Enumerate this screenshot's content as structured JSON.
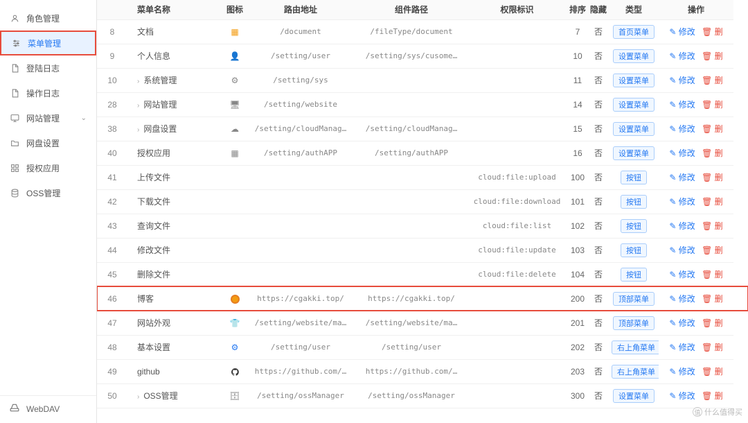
{
  "sidebar": {
    "items": [
      {
        "label": "角色管理",
        "icon": "user-icon"
      },
      {
        "label": "菜单管理",
        "icon": "sliders-icon",
        "active": true
      },
      {
        "label": "登陆日志",
        "icon": "file-icon"
      },
      {
        "label": "操作日志",
        "icon": "file-icon"
      },
      {
        "label": "网站管理",
        "icon": "monitor-icon",
        "expandable": true
      },
      {
        "label": "网盘设置",
        "icon": "folder-icon"
      },
      {
        "label": "授权应用",
        "icon": "app-icon"
      },
      {
        "label": "OSS管理",
        "icon": "database-icon"
      }
    ],
    "bottom": {
      "label": "WebDAV",
      "icon": "drive-icon"
    }
  },
  "headers": {
    "id": "",
    "name": "菜单名称",
    "icon": "图标",
    "route": "路由地址",
    "component": "组件路径",
    "permission": "权限标识",
    "sort": "排序",
    "hidden": "隐藏",
    "type": "类型",
    "ops": "操作"
  },
  "typeLabels": {
    "home": "首页菜单",
    "setting": "设置菜单",
    "button": "按钮",
    "top": "顶部菜单",
    "corner": "右上角菜单"
  },
  "opsLabels": {
    "edit": "修改",
    "delete": "删"
  },
  "hiddenNo": "否",
  "rows": [
    {
      "id": 8,
      "name": "文档",
      "icon": "doc",
      "route": "/document",
      "component": "/fileType/document",
      "perm": "",
      "sort": 7,
      "hidden": "否",
      "type": "home"
    },
    {
      "id": 9,
      "name": "个人信息",
      "icon": "person",
      "route": "/setting/user",
      "component": "/setting/sys/cusome…",
      "perm": "",
      "sort": 10,
      "hidden": "否",
      "type": "setting"
    },
    {
      "id": 10,
      "name": "系统管理",
      "expand": true,
      "icon": "gear",
      "route": "/setting/sys",
      "component": "",
      "perm": "",
      "sort": 11,
      "hidden": "否",
      "type": "setting"
    },
    {
      "id": 28,
      "name": "网站管理",
      "expand": true,
      "icon": "monitor",
      "route": "/setting/website",
      "component": "",
      "perm": "",
      "sort": 14,
      "hidden": "否",
      "type": "setting"
    },
    {
      "id": 38,
      "name": "网盘设置",
      "expand": true,
      "icon": "cloud",
      "route": "/setting/cloudManag…",
      "component": "/setting/cloudManag…",
      "perm": "",
      "sort": 15,
      "hidden": "否",
      "type": "setting"
    },
    {
      "id": 40,
      "name": "授权应用",
      "icon": "app",
      "route": "/setting/authAPP",
      "component": "/setting/authAPP",
      "perm": "",
      "sort": 16,
      "hidden": "否",
      "type": "setting"
    },
    {
      "id": 41,
      "name": "上传文件",
      "icon": "",
      "route": "",
      "component": "",
      "perm": "cloud:file:upload",
      "sort": 100,
      "hidden": "否",
      "type": "button"
    },
    {
      "id": 42,
      "name": "下载文件",
      "icon": "",
      "route": "",
      "component": "",
      "perm": "cloud:file:download",
      "sort": 101,
      "hidden": "否",
      "type": "button"
    },
    {
      "id": 43,
      "name": "查询文件",
      "icon": "",
      "route": "",
      "component": "",
      "perm": "cloud:file:list",
      "sort": 102,
      "hidden": "否",
      "type": "button"
    },
    {
      "id": 44,
      "name": "修改文件",
      "icon": "",
      "route": "",
      "component": "",
      "perm": "cloud:file:update",
      "sort": 103,
      "hidden": "否",
      "type": "button"
    },
    {
      "id": 45,
      "name": "删除文件",
      "icon": "",
      "route": "",
      "component": "",
      "perm": "cloud:file:delete",
      "sort": 104,
      "hidden": "否",
      "type": "button"
    },
    {
      "id": 46,
      "name": "博客",
      "icon": "orange-circle",
      "route": "https://cgakki.top/",
      "component": "https://cgakki.top/",
      "perm": "",
      "sort": 200,
      "hidden": "否",
      "type": "top",
      "highlight": true
    },
    {
      "id": 47,
      "name": "网站外观",
      "icon": "shirt",
      "route": "/setting/website/ma…",
      "component": "/setting/website/ma…",
      "perm": "",
      "sort": 201,
      "hidden": "否",
      "type": "top"
    },
    {
      "id": 48,
      "name": "基本设置",
      "icon": "gear-blue",
      "route": "/setting/user",
      "component": "/setting/user",
      "perm": "",
      "sort": 202,
      "hidden": "否",
      "type": "corner"
    },
    {
      "id": 49,
      "name": "github",
      "icon": "github",
      "route": "https://github.com/…",
      "component": "https://github.com/…",
      "perm": "",
      "sort": 203,
      "hidden": "否",
      "type": "corner"
    },
    {
      "id": 50,
      "name": "OSS管理",
      "expand": true,
      "icon": "database",
      "route": "/setting/ossManager",
      "component": "/setting/ossManager",
      "perm": "",
      "sort": 300,
      "hidden": "否",
      "type": "setting"
    }
  ],
  "watermark": "什么值得买"
}
